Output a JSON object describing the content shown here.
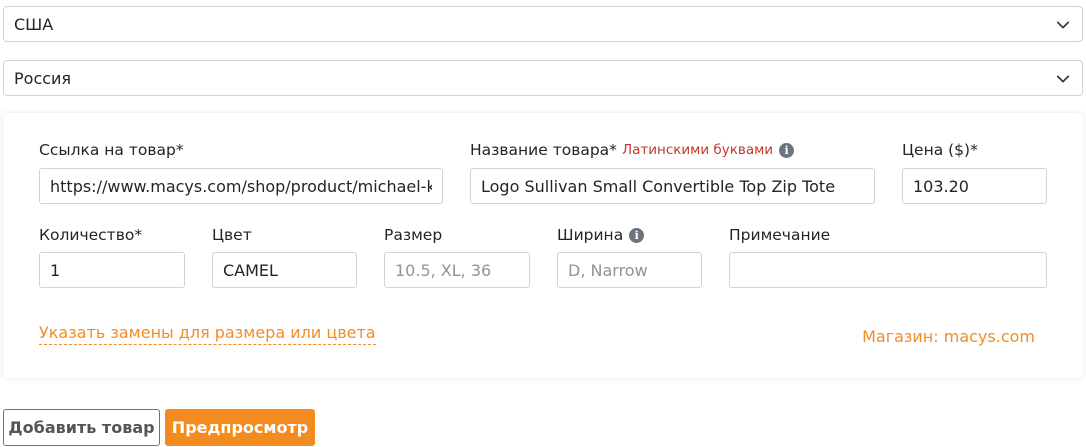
{
  "country_from": {
    "value": "США"
  },
  "country_to": {
    "value": "Россия"
  },
  "form": {
    "url": {
      "label": "Ссылка на товар*",
      "value": "https://www.macys.com/shop/product/michael-kors"
    },
    "name": {
      "label": "Название товара*",
      "hint": "Латинскими буквами",
      "value": "Logo Sullivan Small Convertible Top Zip Tote"
    },
    "price": {
      "label": "Цена ($)*",
      "value": "103.20"
    },
    "quantity": {
      "label": "Количество*",
      "value": "1"
    },
    "color": {
      "label": "Цвет",
      "value": "CAMEL"
    },
    "size": {
      "label": "Размер",
      "placeholder": "10.5, XL, 36"
    },
    "width": {
      "label": "Ширина",
      "placeholder": "D, Narrow"
    },
    "note": {
      "label": "Примечание",
      "value": ""
    },
    "substitutes_link": "Указать замены для размера или цвета",
    "store": "Магазин: macys.com"
  },
  "buttons": {
    "add": "Добавить товар",
    "preview": "Предпросмотр"
  },
  "colors": {
    "accent": "#f28c1e",
    "hint": "#c0392b"
  },
  "icons": {
    "dropdown": "chevron-down-icon",
    "info": "info-icon"
  }
}
